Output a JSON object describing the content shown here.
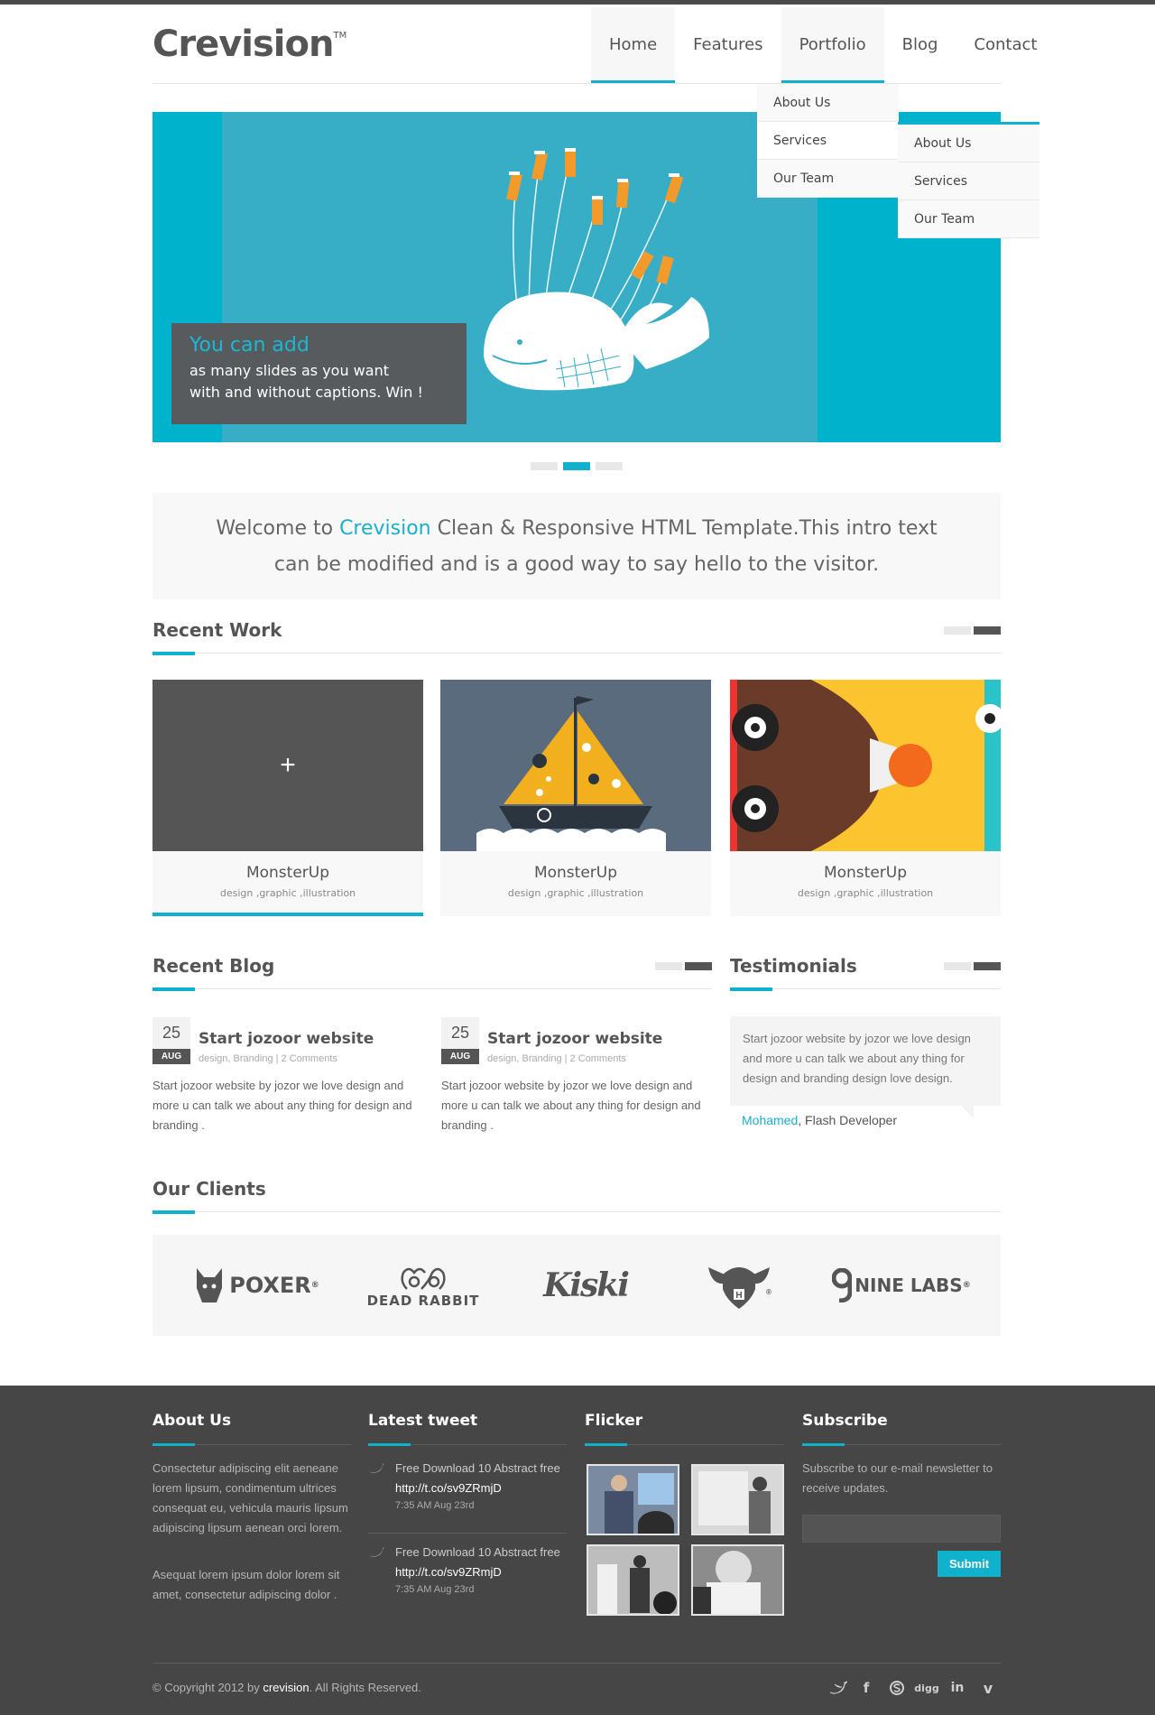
{
  "header": {
    "logo": "Crevision",
    "tm": "TM",
    "nav": [
      "Home",
      "Features",
      "Portfolio",
      "Blog",
      "Contact"
    ],
    "dropdown_main": [
      "About Us",
      "Services",
      "Our Team"
    ],
    "dropdown_sub": [
      "About Us",
      "Services",
      "Our Team"
    ]
  },
  "slider": {
    "caption_title": "You can add",
    "caption_line1": "as many slides as you want",
    "caption_line2": "with and without captions. Win !",
    "active_dot": 2,
    "dot_count": 3
  },
  "intro": {
    "prefix": "Welcome to ",
    "brand": "Crevision",
    "line1_rest": " Clean & Responsive HTML Template.This intro text",
    "line2": "can be modified and is a good way to say hello to the visitor."
  },
  "recent_work": {
    "title": "Recent Work",
    "items": [
      {
        "title": "MonsterUp",
        "cats": "design ,graphic ,illustration",
        "overlay_icon": "+"
      },
      {
        "title": "MonsterUp",
        "cats": "design ,graphic ,illustration"
      },
      {
        "title": "MonsterUp",
        "cats": "design ,graphic ,illustration"
      }
    ]
  },
  "recent_blog": {
    "title": "Recent Blog",
    "posts": [
      {
        "day": "25",
        "month": "AUG",
        "title": "Start jozoor website",
        "meta": "design, Branding  |  2 Comments",
        "body": "Start jozoor website by jozor we love design and more u can talk we about any thing for design and branding ."
      },
      {
        "day": "25",
        "month": "AUG",
        "title": "Start jozoor website",
        "meta": "design, Branding  |  2 Comments",
        "body": "Start jozoor website by jozor we love design and more u can talk we about any thing for design and branding ."
      }
    ]
  },
  "testimonials": {
    "title": "Testimonials",
    "quote": "Start jozoor website by jozor we love design and more u can talk we about any thing for design and branding design love design.",
    "author": "Mohamed",
    "role": ", Flash Developer"
  },
  "clients": {
    "title": "Our Clients",
    "logos": [
      "POXER",
      "DEAD RABBIT",
      "Kiski",
      "NINE LABS"
    ],
    "registered": "®"
  },
  "footer": {
    "about_title": "About Us",
    "about_p1": "Consectetur adipiscing elit aeneane lorem lipsum, condimentum ultrices consequat eu, vehicula mauris lipsum adipiscing lipsum aenean orci lorem.",
    "about_p2": "Asequat lorem ipsum dolor lorem sit amet, consectetur adipiscing dolor .",
    "tweet_title": "Latest tweet",
    "tweets": [
      {
        "text": "Free Download 10 Abstract free",
        "link": "http://t.co/sv9ZRmjD",
        "time": "7:35 AM Aug 23rd"
      },
      {
        "text": "Free Download 10 Abstract free",
        "link": "http://t.co/sv9ZRmjD",
        "time": "7:35 AM Aug 23rd"
      }
    ],
    "flicker_title": "Flicker",
    "subscribe_title": "Subscribe",
    "subscribe_text": "Subscribe to our e-mail newsletter to receive updates.",
    "submit_label": "Submit",
    "copyright_prefix": "© Copyright 2012 by ",
    "copyright_brand": "crevision",
    "copyright_suffix": ". All Rights Reserved.",
    "social": [
      "twitter-icon",
      "facebook-icon",
      "skype-icon",
      "digg-icon",
      "linkedin-icon",
      "vimeo-icon"
    ],
    "social_labels": {
      "digg": "digg",
      "linkedin": "in",
      "facebook": "f",
      "vimeo": "v"
    }
  },
  "colors": {
    "accent": "#0fb1cc",
    "dark": "#464646",
    "slider_bg": "#00b2cc"
  }
}
